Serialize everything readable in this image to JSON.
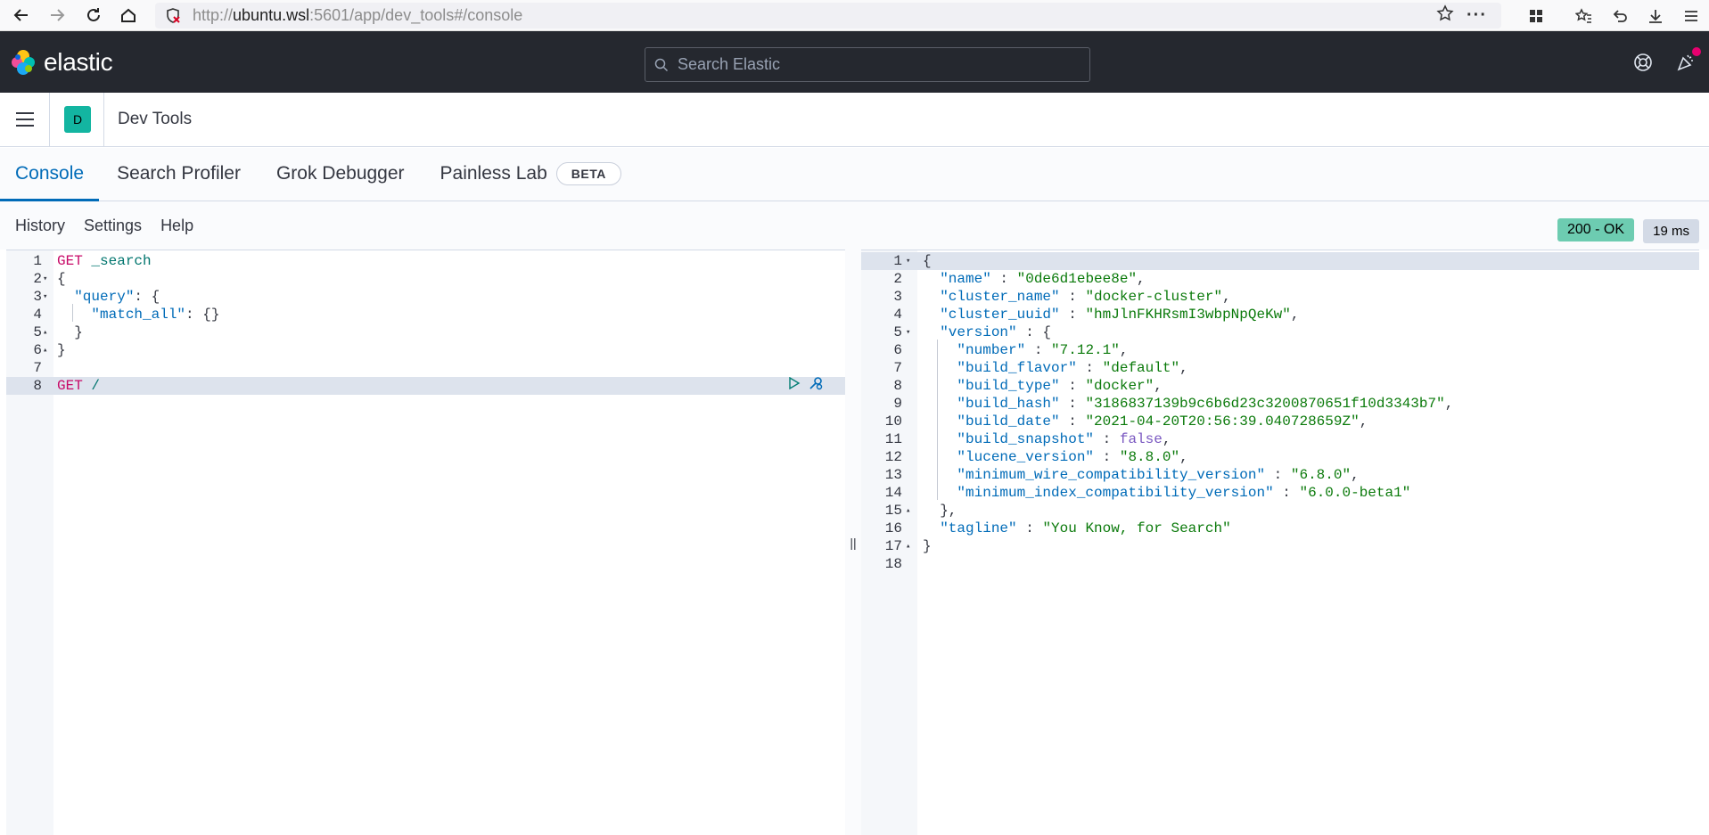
{
  "browser": {
    "url_prefix": "http://",
    "url_host": "ubuntu.wsl",
    "url_rest": ":5601/app/dev_tools#/console"
  },
  "header": {
    "brand": "elastic",
    "search_placeholder": "Search Elastic"
  },
  "appbar": {
    "avatar_letter": "D",
    "title": "Dev Tools"
  },
  "tabs": [
    {
      "label": "Console",
      "active": true
    },
    {
      "label": "Search Profiler"
    },
    {
      "label": "Grok Debugger"
    },
    {
      "label": "Painless Lab",
      "badge": "BETA"
    }
  ],
  "toolbar": {
    "history": "History",
    "settings": "Settings",
    "help": "Help",
    "status": "200 - OK",
    "time": "19 ms"
  },
  "request_lines": [
    {
      "n": "1",
      "fold": "",
      "text": "GET _search"
    },
    {
      "n": "2",
      "fold": "▾",
      "text": "{"
    },
    {
      "n": "3",
      "fold": "▾",
      "text": "  \"query\": {"
    },
    {
      "n": "4",
      "fold": "",
      "text": "    \"match_all\": {}"
    },
    {
      "n": "5",
      "fold": "▴",
      "text": "  }"
    },
    {
      "n": "6",
      "fold": "▴",
      "text": "}"
    },
    {
      "n": "7",
      "fold": "",
      "text": ""
    },
    {
      "n": "8",
      "fold": "",
      "text": "GET /"
    }
  ],
  "response_lines": [
    {
      "n": "1",
      "fold": "▾",
      "text": "{"
    },
    {
      "n": "2",
      "fold": "",
      "text": "  \"name\" : \"0de6d1ebee8e\","
    },
    {
      "n": "3",
      "fold": "",
      "text": "  \"cluster_name\" : \"docker-cluster\","
    },
    {
      "n": "4",
      "fold": "",
      "text": "  \"cluster_uuid\" : \"hmJlnFKHRsmI3wbpNpQeKw\","
    },
    {
      "n": "5",
      "fold": "▾",
      "text": "  \"version\" : {"
    },
    {
      "n": "6",
      "fold": "",
      "text": "    \"number\" : \"7.12.1\","
    },
    {
      "n": "7",
      "fold": "",
      "text": "    \"build_flavor\" : \"default\","
    },
    {
      "n": "8",
      "fold": "",
      "text": "    \"build_type\" : \"docker\","
    },
    {
      "n": "9",
      "fold": "",
      "text": "    \"build_hash\" : \"3186837139b9c6b6d23c3200870651f10d3343b7\","
    },
    {
      "n": "10",
      "fold": "",
      "text": "    \"build_date\" : \"2021-04-20T20:56:39.040728659Z\","
    },
    {
      "n": "11",
      "fold": "",
      "text": "    \"build_snapshot\" : false,"
    },
    {
      "n": "12",
      "fold": "",
      "text": "    \"lucene_version\" : \"8.8.0\","
    },
    {
      "n": "13",
      "fold": "",
      "text": "    \"minimum_wire_compatibility_version\" : \"6.8.0\","
    },
    {
      "n": "14",
      "fold": "",
      "text": "    \"minimum_index_compatibility_version\" : \"6.0.0-beta1\""
    },
    {
      "n": "15",
      "fold": "▴",
      "text": "  },"
    },
    {
      "n": "16",
      "fold": "",
      "text": "  \"tagline\" : \"You Know, for Search\""
    },
    {
      "n": "17",
      "fold": "▴",
      "text": "}"
    },
    {
      "n": "18",
      "fold": "",
      "text": ""
    }
  ],
  "colors": {
    "accent": "#006bb8",
    "status_ok": "#6dccb1",
    "header_bg": "#25282f",
    "avatar_bg": "#13b5a1"
  }
}
